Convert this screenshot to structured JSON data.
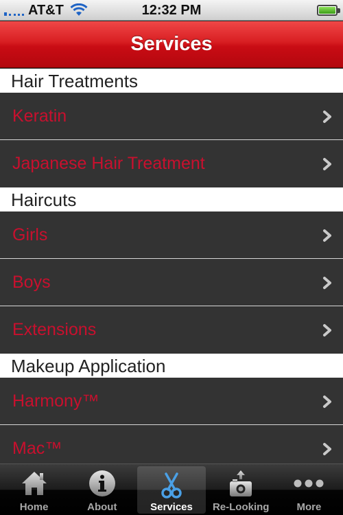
{
  "status_bar": {
    "carrier": "AT&T",
    "time": "12:32 PM"
  },
  "nav_bar": {
    "title": "Services"
  },
  "sections": [
    {
      "header": "Hair Treatments",
      "items": [
        "Keratin",
        "Japanese Hair Treatment"
      ]
    },
    {
      "header": "Haircuts",
      "items": [
        "Girls",
        "Boys",
        "Extensions"
      ]
    },
    {
      "header": "Makeup Application",
      "items": [
        "Harmony™",
        "Mac™"
      ]
    }
  ],
  "tab_bar": {
    "active": "Services",
    "tabs": [
      {
        "label": "Home",
        "icon": "home-icon"
      },
      {
        "label": "About",
        "icon": "info-icon"
      },
      {
        "label": "Services",
        "icon": "scissors-icon"
      },
      {
        "label": "Re-Looking",
        "icon": "camera-upload-icon"
      },
      {
        "label": "More",
        "icon": "more-dots-icon"
      }
    ]
  },
  "colors": {
    "nav_red": "#d81e22",
    "item_text_red": "#c8102e",
    "row_bg": "#333333",
    "active_icon_blue": "#4aa0e6"
  }
}
